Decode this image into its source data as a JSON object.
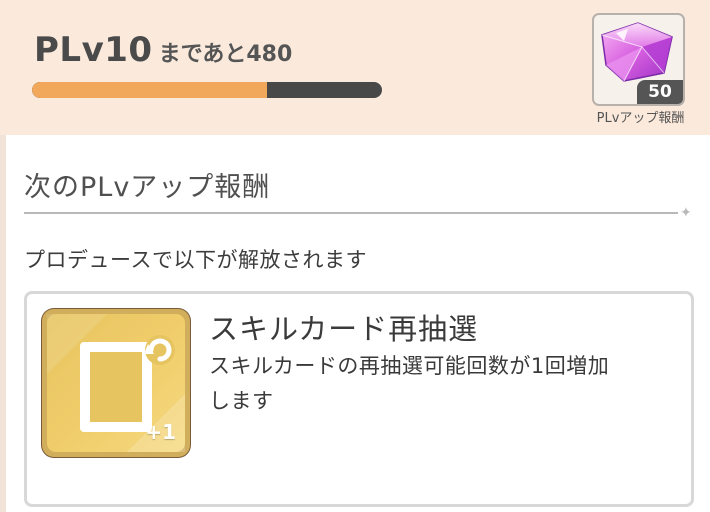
{
  "progress": {
    "level_label": "PLv10",
    "remaining_label": "まであと480",
    "fill_fraction": 0.67
  },
  "reward_tile": {
    "icon": "crystal-gem-icon",
    "count": "50",
    "caption": "PLvアップ報酬",
    "color": "#d56adf"
  },
  "section": {
    "title": "次のPLvアップ報酬",
    "info": "プロデュースで以下が解放されます"
  },
  "card": {
    "icon": "skill-card-reroll-icon",
    "icon_badge": "+1",
    "title": "スキルカード再抽選",
    "description": "スキルカードの再抽選可能回数が1回増加します"
  },
  "colors": {
    "accent": "#f2a85b",
    "bar_track": "#484848",
    "header_bg": "#fbeadc",
    "card_icon": "#e6c460"
  }
}
